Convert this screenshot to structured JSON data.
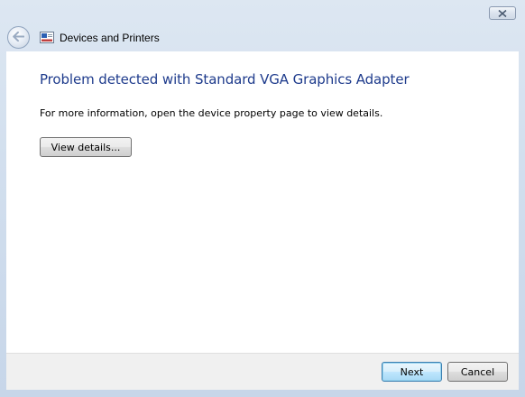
{
  "window": {
    "title": "Devices and Printers"
  },
  "icons": {
    "close": "close-icon",
    "back": "back-arrow-icon",
    "app": "devices-and-printers-icon"
  },
  "main": {
    "heading": "Problem detected with Standard VGA Graphics Adapter",
    "info": "For more information, open the device property page to view details.",
    "view_details_label": "View details..."
  },
  "footer": {
    "next_label": "Next",
    "cancel_label": "Cancel"
  },
  "colors": {
    "heading": "#1e3b8c",
    "content_bg": "#ffffff",
    "footer_bg": "#f0f0f0",
    "frame": "#d2dfee"
  }
}
